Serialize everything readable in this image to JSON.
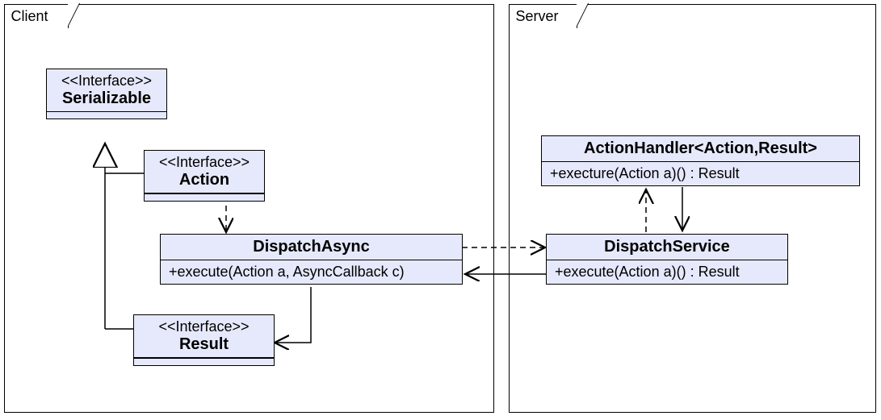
{
  "packages": {
    "client": {
      "label": "Client"
    },
    "server": {
      "label": "Server"
    }
  },
  "classes": {
    "serializable": {
      "stereotype": "<<Interface>>",
      "name": "Serializable"
    },
    "action": {
      "stereotype": "<<Interface>>",
      "name": "Action"
    },
    "result": {
      "stereotype": "<<Interface>>",
      "name": "Result"
    },
    "dispatchAsync": {
      "name": "DispatchAsync",
      "members": [
        "+execute(Action a, AsyncCallback c)"
      ]
    },
    "actionHandler": {
      "name": "ActionHandler<Action,Result>",
      "members": [
        "+execture(Action a)() : Result"
      ]
    },
    "dispatchService": {
      "name": "DispatchService",
      "members": [
        "+execute(Action a)() : Result"
      ]
    }
  }
}
